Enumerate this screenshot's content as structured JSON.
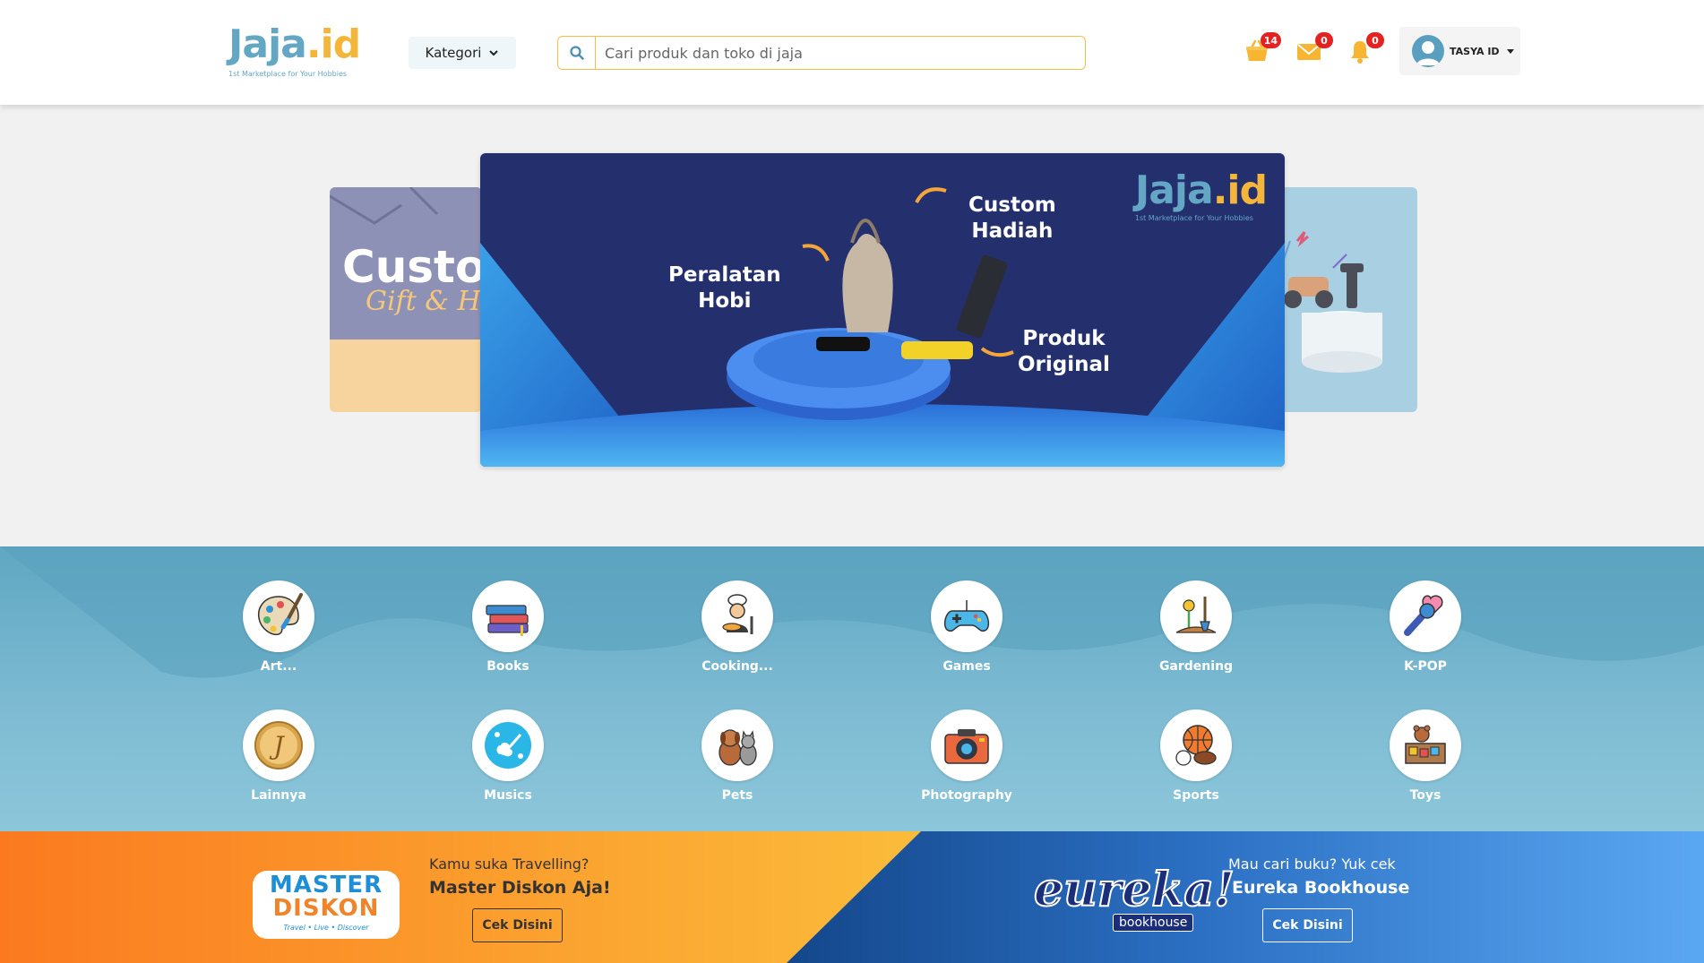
{
  "header": {
    "logo": {
      "main": "Jaja",
      "accent": ".id",
      "tagline": "1st Marketplace for Your Hobbies"
    },
    "kategori_label": "Kategori",
    "search": {
      "placeholder": "Cari produk dan toko di jaja",
      "value": ""
    },
    "cart_badge": "14",
    "mail_badge": "0",
    "bell_badge": "0",
    "user_name": "TASYA ID"
  },
  "banner": {
    "left_card": {
      "line1": "Custom",
      "line2": "Gift & Ham"
    },
    "main": {
      "label_left": [
        "Peralatan",
        "Hobi"
      ],
      "label_top": [
        "Custom",
        "Hadiah"
      ],
      "label_right": [
        "Produk",
        "Original"
      ],
      "logo_main": "Jaja",
      "logo_accent": ".id",
      "logo_tagline": "1st Marketplace for Your Hobbies"
    }
  },
  "categories": [
    {
      "label": "Art...",
      "icon": "art-palette-icon"
    },
    {
      "label": "Books",
      "icon": "books-icon"
    },
    {
      "label": "Cooking...",
      "icon": "chef-cooking-icon"
    },
    {
      "label": "Games",
      "icon": "gamepad-icon"
    },
    {
      "label": "Gardening",
      "icon": "gardening-icon"
    },
    {
      "label": "K-POP",
      "icon": "microphone-heart-icon"
    },
    {
      "label": "Lainnya",
      "icon": "coin-j-icon"
    },
    {
      "label": "Musics",
      "icon": "guitar-music-icon"
    },
    {
      "label": "Pets",
      "icon": "dog-cat-icon"
    },
    {
      "label": "Photography",
      "icon": "camera-icon"
    },
    {
      "label": "Sports",
      "icon": "sports-balls-icon"
    },
    {
      "label": "Toys",
      "icon": "toy-box-icon"
    }
  ],
  "promo": {
    "left": {
      "logo_line1": "MASTER",
      "logo_line2": "DISKON",
      "logo_sub": "Travel • Live • Discover",
      "question": "Kamu suka Travelling?",
      "title": "Master Diskon Aja!",
      "button": "Cek Disini"
    },
    "right": {
      "logo_main": "eureka!",
      "logo_sub": "bookhouse",
      "question": "Mau cari buku? Yuk cek",
      "title": "Eureka Bookhouse",
      "button": "Cek Disini"
    }
  },
  "colors": {
    "brand_blue": "#64a7c4",
    "brand_yellow": "#f4b63a",
    "badge_red": "#e52222",
    "banner_navy": "#242f6e"
  }
}
